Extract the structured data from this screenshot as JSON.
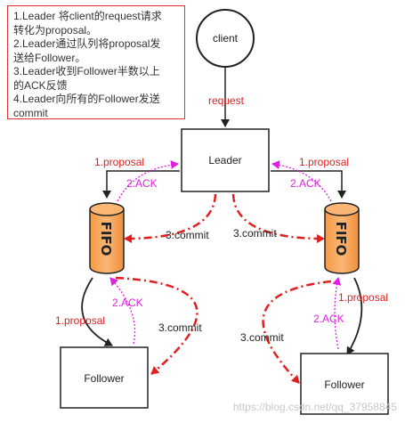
{
  "note": {
    "lines": [
      "1.Leader 将client的request请求",
      "转化为proposal。",
      "2.Leader通过队列将proposal发",
      "送给Follower。",
      "3.Leader收到Follower半数以上",
      "的ACK反馈",
      "4.Leader向所有的Follower发送",
      "commit"
    ]
  },
  "nodes": {
    "client": "client",
    "leader": "Leader",
    "follower_left": "Follower",
    "follower_right": "Follower",
    "fifo_left": "FIFO",
    "fifo_right": "FIFO"
  },
  "edges": {
    "request": "request",
    "proposal_leader_left": "1.proposal",
    "ack_leader_left": "2.ACK",
    "proposal_leader_right": "1.proposal",
    "ack_leader_right": "2.ACK",
    "commit_leader_left": "3.commit",
    "commit_leader_right": "3.commit",
    "proposal_fifo_left": "1.proposal",
    "ack_fifo_left": "2.ACK",
    "commit_follower_left": "3.commit",
    "proposal_fifo_right": "1.proposal",
    "ack_fifo_right": "2.ACK",
    "commit_follower_right": "3.commit"
  },
  "watermark": "https://blog.csdn.net/qq_37958845",
  "colors": {
    "proposal": "#e02020",
    "ack": "#e020e0",
    "commit": "#e02020",
    "fifo": "#f7a85e",
    "note_border": "#e03030"
  }
}
